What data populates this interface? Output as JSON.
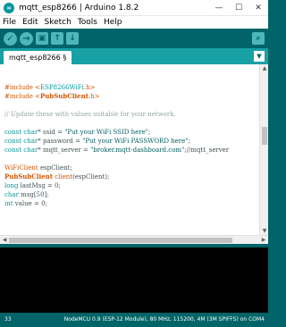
{
  "window": {
    "app_icon": "arduino-icon",
    "title": "mqtt_esp8266 | Arduino 1.8.2",
    "controls": {
      "minimize": "—",
      "maximize": "☐",
      "close": "✕"
    }
  },
  "menu": {
    "items": [
      "File",
      "Edit",
      "Sketch",
      "Tools",
      "Help"
    ]
  },
  "toolbar": {
    "verify_icon": "✓",
    "upload_icon": "→",
    "new_icon": "▣",
    "open_icon": "↑",
    "save_icon": "↓",
    "serial_monitor_icon": "⌕"
  },
  "tabs": {
    "active": "mqtt_esp8266 §",
    "menu_icon": "▼"
  },
  "editor": {
    "lines": [
      [],
      [
        {
          "t": "#include <",
          "c": "kw-orange"
        },
        {
          "t": "ESP8266WiFi",
          "c": "kw-teal"
        },
        {
          "t": ".h>",
          "c": "kw-orange"
        }
      ],
      [
        {
          "t": "#include <",
          "c": "kw-orange"
        },
        {
          "t": "PubSubClient",
          "c": "kw-bold"
        },
        {
          "t": ".h>",
          "c": "kw-orange"
        }
      ],
      [],
      [
        {
          "t": "// Update these with values suitable for your network.",
          "c": "comment"
        }
      ],
      [],
      [
        {
          "t": "const",
          "c": "kw-teal"
        },
        {
          "t": " "
        },
        {
          "t": "char",
          "c": "kw-teal"
        },
        {
          "t": "* ssid = "
        },
        {
          "t": "\"Put your WiFi SSID here\"",
          "c": "str"
        },
        {
          "t": ";"
        }
      ],
      [
        {
          "t": "const",
          "c": "kw-teal"
        },
        {
          "t": " "
        },
        {
          "t": "char",
          "c": "kw-teal"
        },
        {
          "t": "* password = "
        },
        {
          "t": "\"Put your WiFi PASSWORD here\"",
          "c": "str"
        },
        {
          "t": ";"
        }
      ],
      [
        {
          "t": "const",
          "c": "kw-teal"
        },
        {
          "t": " "
        },
        {
          "t": "char",
          "c": "kw-teal"
        },
        {
          "t": "* mqtt_server = "
        },
        {
          "t": "\"broker.mqtt-dashboard.com\"",
          "c": "str"
        },
        {
          "t": ";//mqtt_server"
        }
      ],
      [],
      [
        {
          "t": "WiFiClient",
          "c": "kw-orange"
        },
        {
          "t": " espClient;"
        }
      ],
      [
        {
          "t": "PubSubClient",
          "c": "kw-bold"
        },
        {
          "t": " "
        },
        {
          "t": "client",
          "c": "kw-orange"
        },
        {
          "t": "(espClient);"
        }
      ],
      [
        {
          "t": "long",
          "c": "kw-teal"
        },
        {
          "t": " lastMsg = 0;"
        }
      ],
      [
        {
          "t": "char",
          "c": "kw-teal"
        },
        {
          "t": " msg[50];"
        }
      ],
      [
        {
          "t": "int",
          "c": "kw-teal"
        },
        {
          "t": " value = 0;"
        }
      ],
      [],
      []
    ]
  },
  "status": {
    "line_number": "33",
    "board_info": "NodeMCU 0.9 (ESP-12 Module), 80 MHz, 115200, 4M (3M SPIFFS) on COM4"
  },
  "colors": {
    "ide_teal": "#006468",
    "tab_bar": "#17a1a5",
    "keyword_teal": "#00979c",
    "keyword_orange": "#d35400",
    "comment_gray": "#95a5a6"
  }
}
